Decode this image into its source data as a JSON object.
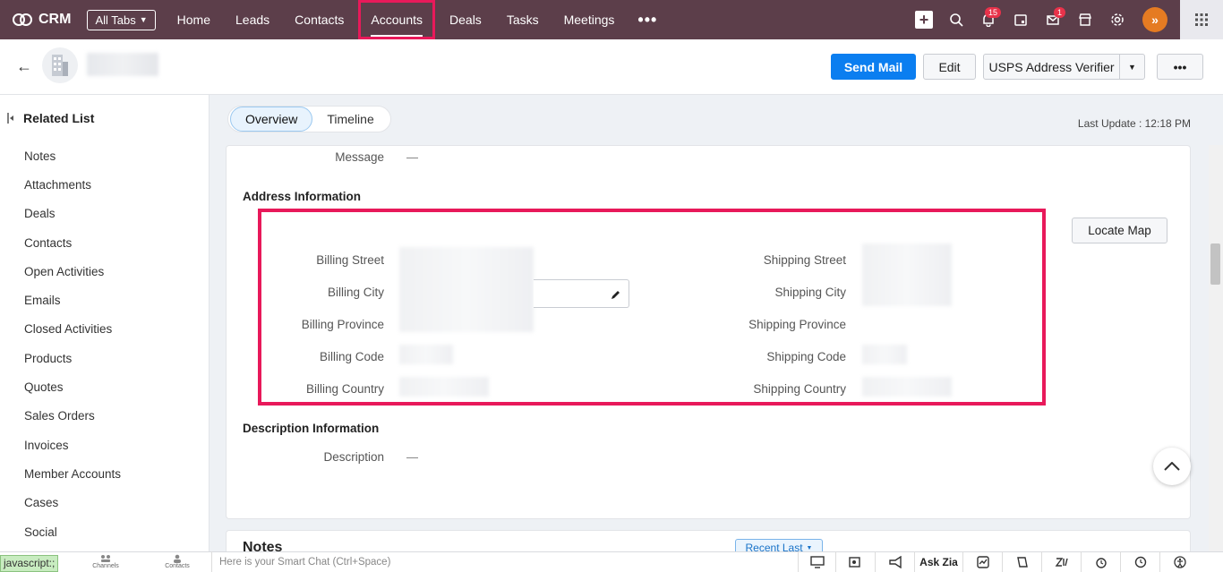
{
  "topbar": {
    "app_name": "CRM",
    "all_tabs_label": "All Tabs",
    "tabs": [
      "Home",
      "Leads",
      "Contacts",
      "Accounts",
      "Deals",
      "Tasks",
      "Meetings"
    ],
    "active_tab": "Accounts",
    "more_label": "•••",
    "notification_count": "15",
    "mail_count": "1",
    "avatar_initial": "»"
  },
  "header": {
    "send_mail_label": "Send Mail",
    "edit_label": "Edit",
    "usps_label": "USPS Address Verifier",
    "more_label": "•••"
  },
  "sidebar": {
    "title": "Related List",
    "items": [
      "Notes",
      "Attachments",
      "Deals",
      "Contacts",
      "Open Activities",
      "Emails",
      "Closed Activities",
      "Products",
      "Quotes",
      "Sales Orders",
      "Invoices",
      "Member Accounts",
      "Cases",
      "Social"
    ]
  },
  "view_tabs": {
    "overview": "Overview",
    "timeline": "Timeline"
  },
  "last_update": "Last Update : 12:18 PM",
  "details": {
    "message_label": "Message",
    "message_value": "—",
    "address_title": "Address Information",
    "billing": {
      "street": "Billing Street",
      "city": "Billing City",
      "province": "Billing Province",
      "code": "Billing Code",
      "country": "Billing Country"
    },
    "shipping": {
      "street": "Shipping Street",
      "city": "Shipping City",
      "province": "Shipping Province",
      "code": "Shipping Code",
      "country": "Shipping Country"
    },
    "locate_map_label": "Locate Map",
    "description_title": "Description Information",
    "description_label": "Description",
    "description_value": "—"
  },
  "notes": {
    "title": "Notes",
    "sort_label": "Recent Last"
  },
  "bottombar": {
    "status_text": "javascript:;",
    "channels_label": "Channels",
    "contacts_label": "Contacts",
    "smartchat_placeholder": "Here is your Smart Chat (Ctrl+Space)",
    "ask_zia_label": "Ask Zia"
  }
}
